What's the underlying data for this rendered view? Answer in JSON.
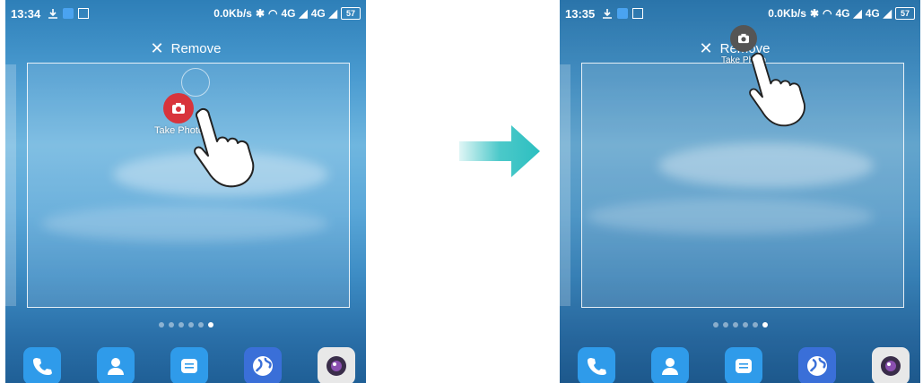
{
  "left_screen": {
    "status": {
      "time": "13:34",
      "speed": "0.0Kb/s",
      "network1": "4G",
      "network2": "4G",
      "battery": "57"
    },
    "remove_label": "Remove",
    "widget_label": "Take Photo",
    "dots_total": 6,
    "dots_active_index": 5
  },
  "right_screen": {
    "status": {
      "time": "13:35",
      "speed": "0.0Kb/s",
      "network1": "4G",
      "network2": "4G",
      "battery": "57"
    },
    "remove_label": "Remove",
    "widget_label": "Take Photo",
    "dots_total": 6,
    "dots_active_index": 5
  },
  "dock_apps": [
    {
      "name": "phone-icon",
      "color": "#2f9bea"
    },
    {
      "name": "contacts-icon",
      "color": "#2f9bea"
    },
    {
      "name": "messages-icon",
      "color": "#2f9bea"
    },
    {
      "name": "browser-icon",
      "color": "#3a6fd8"
    },
    {
      "name": "camera-icon",
      "color": "#e8e8e8"
    }
  ],
  "colors": {
    "take_photo_active": "#d8343c",
    "take_photo_dragged": "#555555",
    "arrow": "#2cbfc0"
  }
}
